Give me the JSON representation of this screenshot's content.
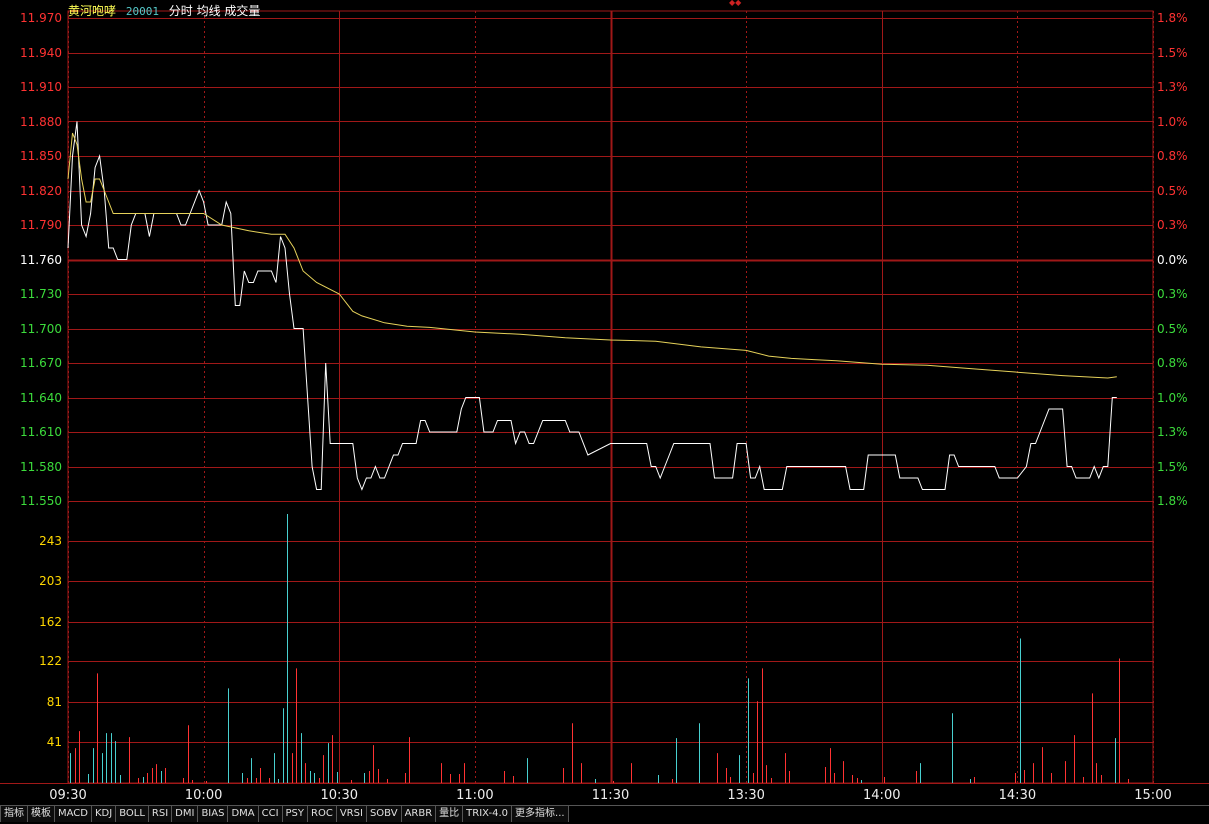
{
  "header": {
    "name": "黄河咆哮",
    "code": "20001",
    "lines": "分时 均线 成交量"
  },
  "colors": {
    "grid": "#a01818",
    "price_line": "#ffffff",
    "avg_line": "#e6d25a",
    "up": "#ff3232",
    "down": "#3cdc3c",
    "volume_up": "#ff3232",
    "volume_down": "#48d0d0",
    "volume_label": "#ffd700"
  },
  "price_axis": {
    "labels": [
      "11.970",
      "11.940",
      "11.910",
      "11.880",
      "11.850",
      "11.820",
      "11.790",
      "11.760",
      "11.730",
      "11.700",
      "11.670",
      "11.640",
      "11.610",
      "11.580",
      "11.550"
    ],
    "pct_labels": [
      "1.8%",
      "1.5%",
      "1.3%",
      "1.0%",
      "0.8%",
      "0.5%",
      "0.3%",
      "0.0%",
      "0.3%",
      "0.5%",
      "0.8%",
      "1.0%",
      "1.3%",
      "1.5%",
      "1.8%"
    ]
  },
  "volume_axis": {
    "labels": [
      "243",
      "203",
      "162",
      "122",
      "81",
      "41"
    ]
  },
  "time_axis": {
    "labels": [
      "09:30",
      "10:00",
      "10:30",
      "11:00",
      "11:30",
      "13:30",
      "14:00",
      "14:30",
      "15:00"
    ]
  },
  "tabs": [
    "指标",
    "模板",
    "MACD",
    "KDJ",
    "BOLL",
    "RSI",
    "DMI",
    "BIAS",
    "DMA",
    "CCI",
    "PSY",
    "ROC",
    "VRSI",
    "SOBV",
    "ARBR",
    "量比",
    "TRIX-4.0",
    "更多指标..."
  ],
  "chart_data": {
    "type": "line",
    "title": "",
    "x_unit": "minutes since 09:30 (trading time, 240 total)",
    "prev_close": 11.76,
    "ylim": [
      11.55,
      11.97
    ],
    "volume_ylim": [
      0,
      283
    ],
    "series": [
      {
        "name": "分时",
        "points": [
          [
            0,
            11.77
          ],
          [
            1,
            11.85
          ],
          [
            2,
            11.88
          ],
          [
            3,
            11.79
          ],
          [
            4,
            11.78
          ],
          [
            5,
            11.8
          ],
          [
            6,
            11.84
          ],
          [
            7,
            11.85
          ],
          [
            8,
            11.82
          ],
          [
            9,
            11.77
          ],
          [
            10,
            11.77
          ],
          [
            11,
            11.76
          ],
          [
            12,
            11.76
          ],
          [
            13,
            11.76
          ],
          [
            14,
            11.79
          ],
          [
            15,
            11.8
          ],
          [
            16,
            11.8
          ],
          [
            17,
            11.8
          ],
          [
            18,
            11.78
          ],
          [
            19,
            11.8
          ],
          [
            22,
            11.8
          ],
          [
            24,
            11.8
          ],
          [
            25,
            11.79
          ],
          [
            26,
            11.79
          ],
          [
            27,
            11.8
          ],
          [
            29,
            11.82
          ],
          [
            30,
            11.81
          ],
          [
            31,
            11.79
          ],
          [
            34,
            11.79
          ],
          [
            35,
            11.81
          ],
          [
            36,
            11.8
          ],
          [
            37,
            11.72
          ],
          [
            38,
            11.72
          ],
          [
            39,
            11.75
          ],
          [
            40,
            11.74
          ],
          [
            41,
            11.74
          ],
          [
            42,
            11.75
          ],
          [
            45,
            11.75
          ],
          [
            46,
            11.74
          ],
          [
            47,
            11.78
          ],
          [
            48,
            11.77
          ],
          [
            49,
            11.73
          ],
          [
            50,
            11.7
          ],
          [
            52,
            11.7
          ],
          [
            54,
            11.58
          ],
          [
            55,
            11.56
          ],
          [
            56,
            11.56
          ],
          [
            57,
            11.67
          ],
          [
            58,
            11.6
          ],
          [
            63,
            11.6
          ],
          [
            64,
            11.57
          ],
          [
            65,
            11.56
          ],
          [
            66,
            11.57
          ],
          [
            67,
            11.57
          ],
          [
            68,
            11.58
          ],
          [
            69,
            11.57
          ],
          [
            70,
            11.57
          ],
          [
            71,
            11.58
          ],
          [
            72,
            11.59
          ],
          [
            73,
            11.59
          ],
          [
            74,
            11.6
          ],
          [
            77,
            11.6
          ],
          [
            78,
            11.62
          ],
          [
            79,
            11.62
          ],
          [
            80,
            11.61
          ],
          [
            86,
            11.61
          ],
          [
            87,
            11.63
          ],
          [
            88,
            11.64
          ],
          [
            91,
            11.64
          ],
          [
            92,
            11.61
          ],
          [
            94,
            11.61
          ],
          [
            95,
            11.62
          ],
          [
            98,
            11.62
          ],
          [
            99,
            11.6
          ],
          [
            100,
            11.61
          ],
          [
            101,
            11.61
          ],
          [
            102,
            11.6
          ],
          [
            103,
            11.6
          ],
          [
            105,
            11.62
          ],
          [
            110,
            11.62
          ],
          [
            111,
            11.61
          ],
          [
            113,
            11.61
          ],
          [
            115,
            11.59
          ],
          [
            120,
            11.6
          ],
          [
            121,
            11.6
          ],
          [
            128,
            11.6
          ],
          [
            129,
            11.58
          ],
          [
            130,
            11.58
          ],
          [
            131,
            11.57
          ],
          [
            133,
            11.59
          ],
          [
            134,
            11.6
          ],
          [
            142,
            11.6
          ],
          [
            143,
            11.57
          ],
          [
            144,
            11.57
          ],
          [
            147,
            11.57
          ],
          [
            148,
            11.6
          ],
          [
            150,
            11.6
          ],
          [
            151,
            11.57
          ],
          [
            152,
            11.57
          ],
          [
            153,
            11.58
          ],
          [
            154,
            11.56
          ],
          [
            158,
            11.56
          ],
          [
            159,
            11.58
          ],
          [
            167,
            11.58
          ],
          [
            172,
            11.58
          ],
          [
            173,
            11.56
          ],
          [
            176,
            11.56
          ],
          [
            177,
            11.59
          ],
          [
            180,
            11.59
          ],
          [
            183,
            11.59
          ],
          [
            184,
            11.57
          ],
          [
            188,
            11.57
          ],
          [
            189,
            11.56
          ],
          [
            194,
            11.56
          ],
          [
            195,
            11.59
          ],
          [
            196,
            11.59
          ],
          [
            197,
            11.58
          ],
          [
            204,
            11.58
          ],
          [
            205,
            11.58
          ],
          [
            206,
            11.57
          ],
          [
            210,
            11.57
          ],
          [
            212,
            11.58
          ],
          [
            213,
            11.6
          ],
          [
            214,
            11.6
          ],
          [
            216,
            11.62
          ],
          [
            217,
            11.63
          ],
          [
            220,
            11.63
          ],
          [
            221,
            11.58
          ],
          [
            222,
            11.58
          ],
          [
            223,
            11.57
          ],
          [
            226,
            11.57
          ],
          [
            227,
            11.58
          ],
          [
            228,
            11.57
          ],
          [
            229,
            11.58
          ],
          [
            230,
            11.58
          ],
          [
            231,
            11.64
          ],
          [
            232,
            11.64
          ]
        ]
      },
      {
        "name": "均线",
        "points": [
          [
            0,
            11.83
          ],
          [
            1,
            11.87
          ],
          [
            2,
            11.86
          ],
          [
            3,
            11.83
          ],
          [
            4,
            11.81
          ],
          [
            5,
            11.81
          ],
          [
            6,
            11.83
          ],
          [
            7,
            11.83
          ],
          [
            8,
            11.82
          ],
          [
            9,
            11.81
          ],
          [
            10,
            11.8
          ],
          [
            12,
            11.8
          ],
          [
            20,
            11.8
          ],
          [
            30,
            11.8
          ],
          [
            34,
            11.79
          ],
          [
            40,
            11.785
          ],
          [
            45,
            11.782
          ],
          [
            48,
            11.782
          ],
          [
            50,
            11.77
          ],
          [
            52,
            11.75
          ],
          [
            55,
            11.74
          ],
          [
            60,
            11.73
          ],
          [
            63,
            11.715
          ],
          [
            65,
            11.711
          ],
          [
            70,
            11.705
          ],
          [
            75,
            11.702
          ],
          [
            80,
            11.701
          ],
          [
            90,
            11.697
          ],
          [
            100,
            11.695
          ],
          [
            110,
            11.692
          ],
          [
            120,
            11.69
          ],
          [
            130,
            11.689
          ],
          [
            140,
            11.684
          ],
          [
            150,
            11.681
          ],
          [
            155,
            11.676
          ],
          [
            160,
            11.674
          ],
          [
            165,
            11.673
          ],
          [
            170,
            11.672
          ],
          [
            180,
            11.669
          ],
          [
            190,
            11.668
          ],
          [
            200,
            11.665
          ],
          [
            210,
            11.662
          ],
          [
            220,
            11.659
          ],
          [
            230,
            11.657
          ],
          [
            232,
            11.658
          ]
        ]
      }
    ],
    "volume": {
      "name": "成交量",
      "bars": [
        [
          0,
          30,
          "down"
        ],
        [
          1,
          35,
          "up"
        ],
        [
          2,
          52,
          "up"
        ],
        [
          4,
          9,
          "down"
        ],
        [
          5,
          35,
          "down"
        ],
        [
          6,
          110,
          "up"
        ],
        [
          7,
          30,
          "down"
        ],
        [
          8,
          50,
          "down"
        ],
        [
          9,
          50,
          "down"
        ],
        [
          10,
          42,
          "down"
        ],
        [
          11,
          8,
          "down"
        ],
        [
          13,
          46,
          "up"
        ],
        [
          15,
          5,
          "up"
        ],
        [
          16,
          6,
          "down"
        ],
        [
          17,
          10,
          "up"
        ],
        [
          18,
          15,
          "up"
        ],
        [
          19,
          19,
          "up"
        ],
        [
          20,
          12,
          "down"
        ],
        [
          21,
          15,
          "up"
        ],
        [
          25,
          5,
          "up"
        ],
        [
          26,
          58,
          "up"
        ],
        [
          27,
          3,
          "up"
        ],
        [
          30,
          2,
          "up"
        ],
        [
          35,
          95,
          "down"
        ],
        [
          38,
          10,
          "down"
        ],
        [
          39,
          5,
          "up"
        ],
        [
          40,
          25,
          "down"
        ],
        [
          41,
          5,
          "up"
        ],
        [
          42,
          15,
          "up"
        ],
        [
          44,
          5,
          "up"
        ],
        [
          45,
          30,
          "down"
        ],
        [
          46,
          4,
          "down"
        ],
        [
          47,
          75,
          "down"
        ],
        [
          48,
          270,
          "down"
        ],
        [
          49,
          30,
          "up"
        ],
        [
          50,
          115,
          "up"
        ],
        [
          51,
          50,
          "down"
        ],
        [
          52,
          20,
          "up"
        ],
        [
          53,
          12,
          "down"
        ],
        [
          54,
          10,
          "down"
        ],
        [
          55,
          5,
          "up"
        ],
        [
          56,
          28,
          "up"
        ],
        [
          57,
          40,
          "down"
        ],
        [
          58,
          48,
          "up"
        ],
        [
          59,
          11,
          "down"
        ],
        [
          62,
          3,
          "up"
        ],
        [
          65,
          10,
          "down"
        ],
        [
          66,
          12,
          "up"
        ],
        [
          67,
          38,
          "up"
        ],
        [
          68,
          14,
          "up"
        ],
        [
          70,
          4,
          "up"
        ],
        [
          74,
          10,
          "up"
        ],
        [
          75,
          46,
          "up"
        ],
        [
          82,
          20,
          "up"
        ],
        [
          84,
          9,
          "up"
        ],
        [
          86,
          9,
          "up"
        ],
        [
          87,
          20,
          "up"
        ],
        [
          96,
          12,
          "up"
        ],
        [
          98,
          7,
          "up"
        ],
        [
          101,
          25,
          "down"
        ],
        [
          109,
          15,
          "up"
        ],
        [
          111,
          60,
          "up"
        ],
        [
          113,
          20,
          "up"
        ],
        [
          116,
          4,
          "down"
        ],
        [
          120,
          2,
          "up"
        ],
        [
          124,
          20,
          "up"
        ],
        [
          130,
          8,
          "down"
        ],
        [
          133,
          4,
          "up"
        ],
        [
          134,
          45,
          "down"
        ],
        [
          139,
          60,
          "down"
        ],
        [
          143,
          30,
          "up"
        ],
        [
          145,
          15,
          "up"
        ],
        [
          146,
          6,
          "up"
        ],
        [
          148,
          28,
          "down"
        ],
        [
          150,
          105,
          "down"
        ],
        [
          151,
          10,
          "up"
        ],
        [
          152,
          82,
          "up"
        ],
        [
          153,
          115,
          "up"
        ],
        [
          154,
          18,
          "up"
        ],
        [
          155,
          5,
          "up"
        ],
        [
          158,
          30,
          "up"
        ],
        [
          159,
          12,
          "up"
        ],
        [
          167,
          16,
          "up"
        ],
        [
          168,
          35,
          "up"
        ],
        [
          169,
          10,
          "up"
        ],
        [
          171,
          22,
          "up"
        ],
        [
          173,
          8,
          "up"
        ],
        [
          174,
          5,
          "up"
        ],
        [
          175,
          3,
          "down"
        ],
        [
          180,
          6,
          "up"
        ],
        [
          187,
          12,
          "up"
        ],
        [
          188,
          20,
          "down"
        ],
        [
          195,
          70,
          "down"
        ],
        [
          199,
          4,
          "down"
        ],
        [
          200,
          6,
          "up"
        ],
        [
          209,
          10,
          "up"
        ],
        [
          210,
          145,
          "down"
        ],
        [
          211,
          13,
          "up"
        ],
        [
          213,
          20,
          "up"
        ],
        [
          215,
          36,
          "up"
        ],
        [
          217,
          10,
          "up"
        ],
        [
          220,
          22,
          "up"
        ],
        [
          222,
          48,
          "up"
        ],
        [
          224,
          6,
          "up"
        ],
        [
          226,
          90,
          "up"
        ],
        [
          227,
          20,
          "up"
        ],
        [
          228,
          8,
          "up"
        ],
        [
          231,
          45,
          "down"
        ],
        [
          232,
          125,
          "up"
        ],
        [
          234,
          4,
          "up"
        ]
      ]
    }
  }
}
